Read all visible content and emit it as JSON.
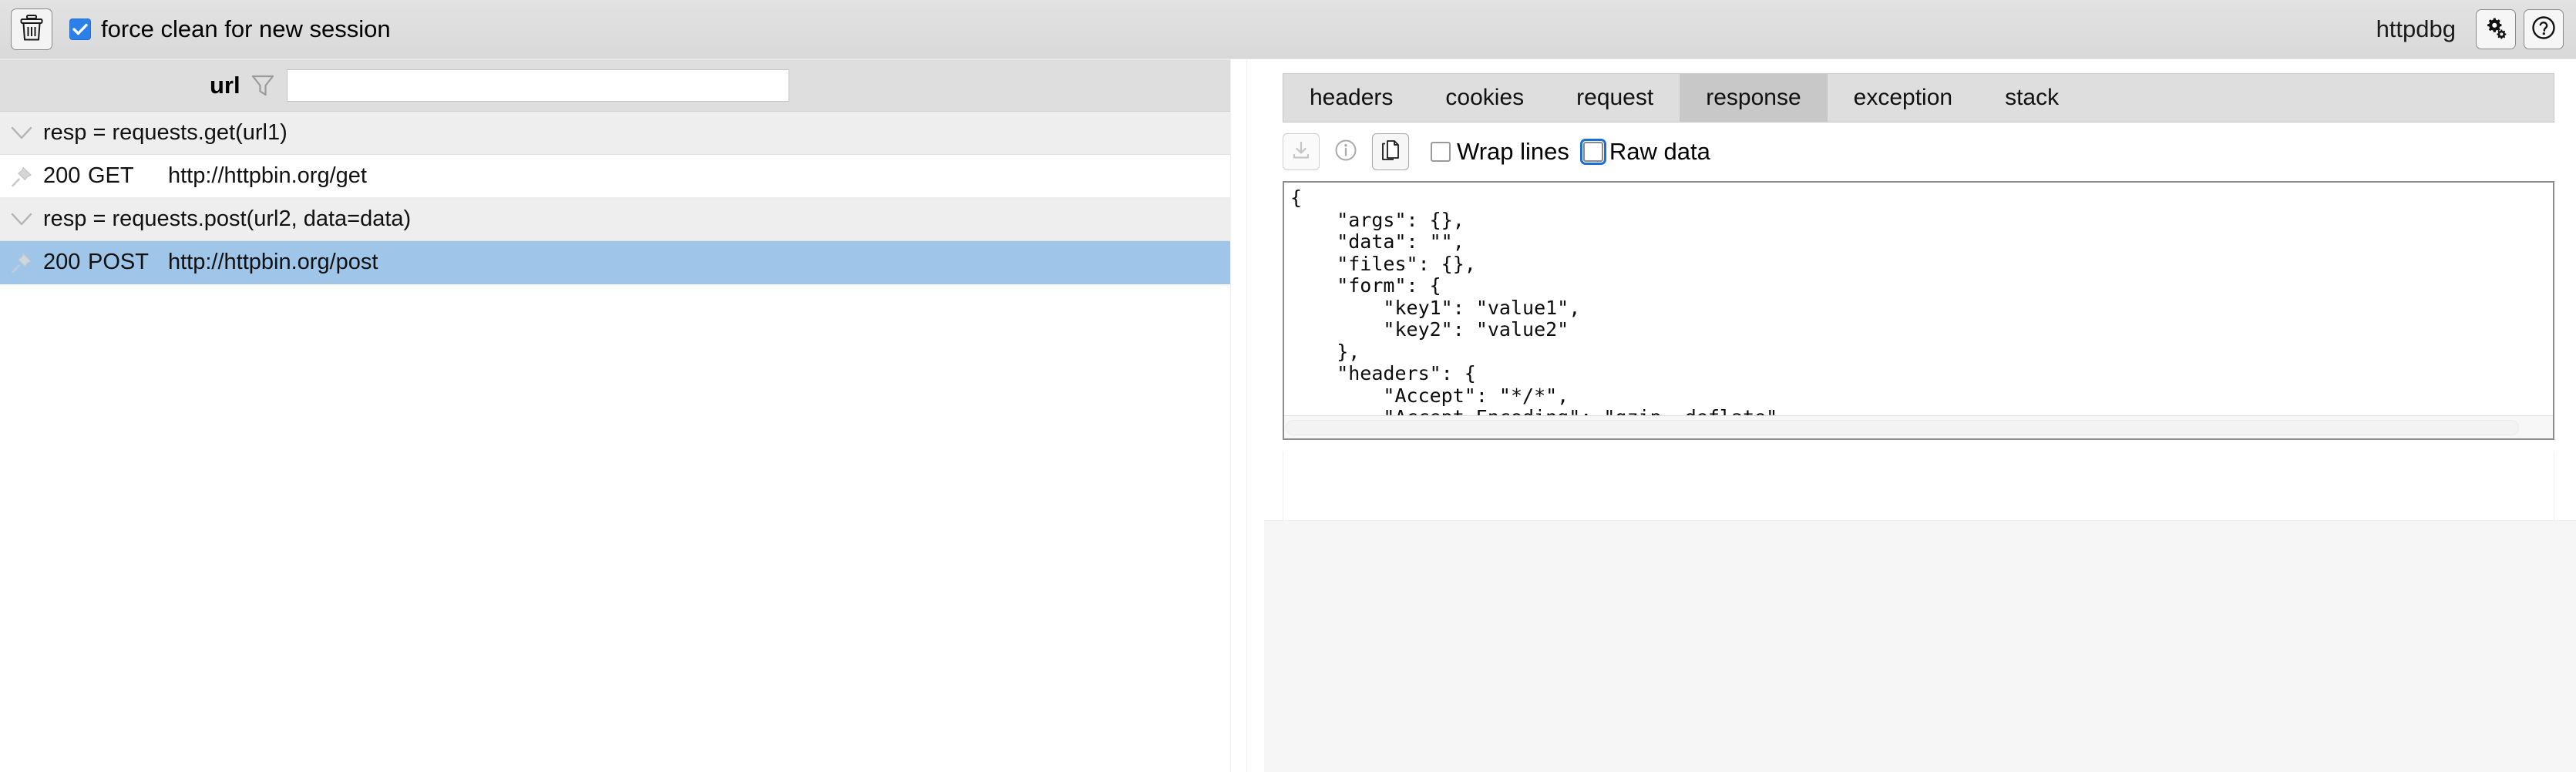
{
  "toolbar": {
    "clear_button_icon": "trash-icon",
    "force_clean_checkbox_label": "force clean for new session",
    "force_clean_checked": true,
    "app_title": "httpdbg",
    "settings_button_icon": "gears-icon",
    "help_button_icon": "question-circle-icon",
    "accent_color": "#2b7fe8"
  },
  "left_panel": {
    "filter": {
      "label": "url",
      "icon": "funnel-icon",
      "value": "",
      "placeholder": ""
    },
    "groups": [
      {
        "label": "resp = requests.get(url1)",
        "expanded": true,
        "requests": [
          {
            "status": "200",
            "method": "GET",
            "url": "http://httpbin.org/get",
            "selected": false,
            "pin_icon": "pin-icon"
          }
        ]
      },
      {
        "label": "resp = requests.post(url2, data=data)",
        "expanded": true,
        "requests": [
          {
            "status": "200",
            "method": "POST",
            "url": "http://httpbin.org/post",
            "selected": true,
            "pin_icon": "pin-icon"
          }
        ]
      }
    ],
    "selected_row_color": "#9fc5e8"
  },
  "right_panel": {
    "tabs": [
      {
        "label": "headers",
        "active": false
      },
      {
        "label": "cookies",
        "active": false
      },
      {
        "label": "request",
        "active": false
      },
      {
        "label": "response",
        "active": true
      },
      {
        "label": "exception",
        "active": false
      },
      {
        "label": "stack",
        "active": false
      }
    ],
    "response_toolbar": {
      "download_icon": "download-icon",
      "download_disabled": true,
      "info_icon": "info-circle-icon",
      "copy_icon": "copy-icon",
      "wrap_lines_label": "Wrap lines",
      "wrap_lines_checked": false,
      "raw_data_label": "Raw data",
      "raw_data_checked": false,
      "raw_data_focused": true
    },
    "response_body": "{\n    \"args\": {},\n    \"data\": \"\",\n    \"files\": {},\n    \"form\": {\n        \"key1\": \"value1\",\n        \"key2\": \"value2\"\n    },\n    \"headers\": {\n        \"Accept\": \"*/*\",\n        \"Accept-Encoding\": \"gzip, deflate\",\n        \"Content-Length\": \"23\",\n        \"Content-Type\": \"application/x-www-form-urlencoded\",\n        \"Host\": \"httpbin.org\",\n        \"User-Agent\": \"python-requests/2.32.3\",\n        \"X-Amzn-Trace-Id\": \"Root=1-66f4dd31-4dad44c8601679807024aaed\"\n    },\n    \"json\": null,\n    \"origin\": \"223.178.208.92\",\n    \"url\": \"http://httpbin.org/post\"\n}"
  }
}
